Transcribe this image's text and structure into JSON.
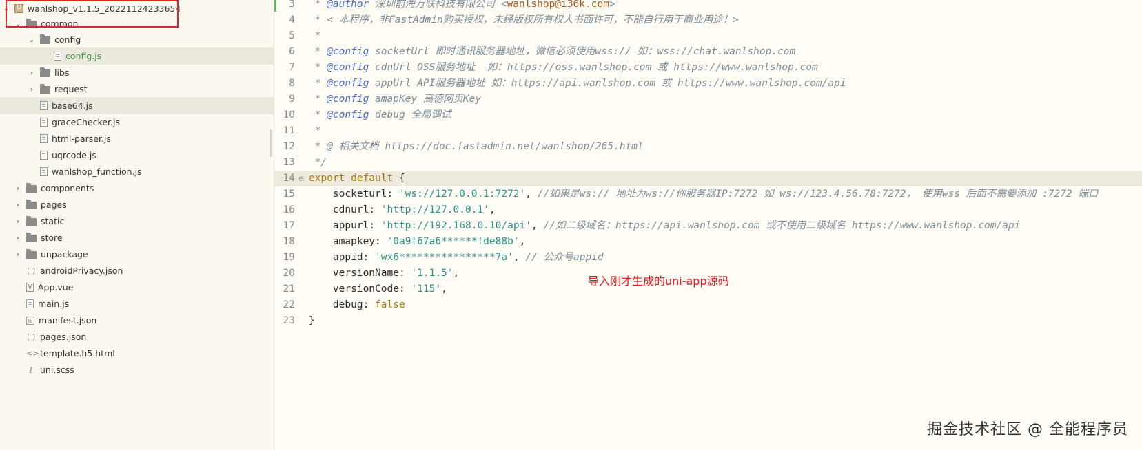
{
  "sidebar": {
    "items": [
      {
        "label": "wanlshop_v1.1.5_20221124233654",
        "icon": "project-icon",
        "arrow": "⌄"
      },
      {
        "label": "common",
        "icon": "folder-icon",
        "arrow": "⌄"
      },
      {
        "label": "config",
        "icon": "folder-icon",
        "arrow": "⌄"
      },
      {
        "label": "config.js",
        "icon": "file-icon",
        "arrow": ""
      },
      {
        "label": "libs",
        "icon": "folder-icon",
        "arrow": "›"
      },
      {
        "label": "request",
        "icon": "folder-icon",
        "arrow": "›"
      },
      {
        "label": "base64.js",
        "icon": "file-icon",
        "arrow": ""
      },
      {
        "label": "graceChecker.js",
        "icon": "file-icon",
        "arrow": ""
      },
      {
        "label": "html-parser.js",
        "icon": "file-icon",
        "arrow": ""
      },
      {
        "label": "uqrcode.js",
        "icon": "file-icon",
        "arrow": ""
      },
      {
        "label": "wanlshop_function.js",
        "icon": "file-icon",
        "arrow": ""
      },
      {
        "label": "components",
        "icon": "folder-icon",
        "arrow": "›"
      },
      {
        "label": "pages",
        "icon": "folder-icon",
        "arrow": "›"
      },
      {
        "label": "static",
        "icon": "folder-icon",
        "arrow": "›"
      },
      {
        "label": "store",
        "icon": "folder-icon",
        "arrow": "›"
      },
      {
        "label": "unpackage",
        "icon": "folder-icon",
        "arrow": "›"
      },
      {
        "label": "androidPrivacy.json",
        "icon": "json-icon",
        "arrow": ""
      },
      {
        "label": "App.vue",
        "icon": "vue-file-icon",
        "arrow": ""
      },
      {
        "label": "main.js",
        "icon": "file-icon",
        "arrow": ""
      },
      {
        "label": "manifest.json",
        "icon": "manifest-icon",
        "arrow": ""
      },
      {
        "label": "pages.json",
        "icon": "json-icon",
        "arrow": ""
      },
      {
        "label": "template.h5.html",
        "icon": "html-code-icon",
        "arrow": ""
      },
      {
        "label": "uni.scss",
        "icon": "scss-icon",
        "arrow": ""
      }
    ]
  },
  "editor": {
    "lines": [
      {
        "n": "3",
        "parts": [
          {
            "c": "cm",
            "t": " * "
          },
          {
            "c": "tag",
            "t": "@author"
          },
          {
            "c": "cm",
            "t": " 深圳前海万联科技有限公司 <"
          },
          {
            "c": "em",
            "t": "wanlshop@i36k.com"
          },
          {
            "c": "cm",
            "t": ">"
          }
        ]
      },
      {
        "n": "4",
        "parts": [
          {
            "c": "cm",
            "t": " * < 本程序，非FastAdmin购买授权，未经版权所有权人书面许可，不能自行用于商业用途！>"
          }
        ]
      },
      {
        "n": "5",
        "parts": [
          {
            "c": "cm",
            "t": " *"
          }
        ]
      },
      {
        "n": "6",
        "parts": [
          {
            "c": "cm",
            "t": " * "
          },
          {
            "c": "tag",
            "t": "@config"
          },
          {
            "c": "cm",
            "t": " socketUrl 即时通讯服务器地址，微信必须使用wss:// 如：wss://chat.wanlshop.com"
          }
        ]
      },
      {
        "n": "7",
        "parts": [
          {
            "c": "cm",
            "t": " * "
          },
          {
            "c": "tag",
            "t": "@config"
          },
          {
            "c": "cm",
            "t": " cdnUrl OSS服务地址  如：https://oss.wanlshop.com 或 https://www.wanlshop.com"
          }
        ]
      },
      {
        "n": "8",
        "parts": [
          {
            "c": "cm",
            "t": " * "
          },
          {
            "c": "tag",
            "t": "@config"
          },
          {
            "c": "cm",
            "t": " appUrl API服务器地址 如：https://api.wanlshop.com 或 https://www.wanlshop.com/api"
          }
        ]
      },
      {
        "n": "9",
        "parts": [
          {
            "c": "cm",
            "t": " * "
          },
          {
            "c": "tag",
            "t": "@config"
          },
          {
            "c": "cm",
            "t": " amapKey 高德网页Key"
          }
        ]
      },
      {
        "n": "10",
        "parts": [
          {
            "c": "cm",
            "t": " * "
          },
          {
            "c": "tag",
            "t": "@config"
          },
          {
            "c": "cm",
            "t": " debug 全局调试"
          }
        ]
      },
      {
        "n": "11",
        "parts": [
          {
            "c": "cm",
            "t": " *"
          }
        ]
      },
      {
        "n": "12",
        "parts": [
          {
            "c": "cm",
            "t": " * @ 相关文档 https://doc.fastadmin.net/wanlshop/265.html"
          }
        ]
      },
      {
        "n": "13",
        "parts": [
          {
            "c": "cm",
            "t": " */"
          }
        ]
      },
      {
        "n": "14",
        "fold": "⊟",
        "parts": [
          {
            "c": "kw",
            "t": "export default"
          },
          {
            "c": "plain",
            "t": " {"
          }
        ]
      },
      {
        "n": "15",
        "parts": [
          {
            "c": "plain",
            "t": "    socketurl: "
          },
          {
            "c": "str",
            "t": "'ws://127.0.0.1:7272'"
          },
          {
            "c": "plain",
            "t": ", "
          },
          {
            "c": "cm",
            "t": "//如果是ws:// 地址为ws://你服务器IP:7272 如 ws://123.4.56.78:7272， 使用wss 后面不需要添加 :7272 端口"
          }
        ]
      },
      {
        "n": "16",
        "parts": [
          {
            "c": "plain",
            "t": "    cdnurl: "
          },
          {
            "c": "str",
            "t": "'http://127.0.0.1'"
          },
          {
            "c": "plain",
            "t": ","
          }
        ]
      },
      {
        "n": "17",
        "parts": [
          {
            "c": "plain",
            "t": "    appurl: "
          },
          {
            "c": "str",
            "t": "'http://192.168.0.10/api'"
          },
          {
            "c": "plain",
            "t": ", "
          },
          {
            "c": "cm",
            "t": "//如二级域名：https://api.wanlshop.com 或不使用二级域名 https://www.wanlshop.com/api"
          }
        ]
      },
      {
        "n": "18",
        "parts": [
          {
            "c": "plain",
            "t": "    amapkey: "
          },
          {
            "c": "str",
            "t": "'0a9f67a6******fde88b'"
          },
          {
            "c": "plain",
            "t": ","
          }
        ]
      },
      {
        "n": "19",
        "parts": [
          {
            "c": "plain",
            "t": "    appid: "
          },
          {
            "c": "str",
            "t": "'wx6****************7a'"
          },
          {
            "c": "plain",
            "t": ", "
          },
          {
            "c": "cm",
            "t": "// 公众号appid"
          }
        ]
      },
      {
        "n": "20",
        "parts": [
          {
            "c": "plain",
            "t": "    versionName: "
          },
          {
            "c": "str",
            "t": "'1.1.5'"
          },
          {
            "c": "plain",
            "t": ","
          }
        ]
      },
      {
        "n": "21",
        "parts": [
          {
            "c": "plain",
            "t": "    versionCode: "
          },
          {
            "c": "str",
            "t": "'115'"
          },
          {
            "c": "plain",
            "t": ","
          }
        ]
      },
      {
        "n": "22",
        "parts": [
          {
            "c": "plain",
            "t": "    debug: "
          },
          {
            "c": "kw",
            "t": "false"
          }
        ]
      },
      {
        "n": "23",
        "parts": [
          {
            "c": "plain",
            "t": "}"
          }
        ]
      }
    ]
  },
  "annotation": "导入刚才生成的uni-app源码",
  "watermark": "掘金技术社区 @ 全能程序员",
  "colors": {
    "annotation": "#e3181d",
    "highlight_box": "#e0262c",
    "selected_file": "#3c9a3c"
  }
}
